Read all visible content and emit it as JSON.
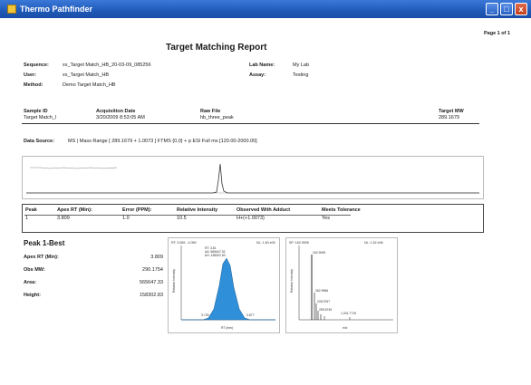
{
  "window": {
    "title": "Thermo Pathfinder",
    "buttons": [
      "_",
      "□",
      "x"
    ]
  },
  "report": {
    "page_number": "Page 1 of 1",
    "title": "Target Matching Report",
    "header": {
      "sequence_label": "Sequence:",
      "sequence_value": "xx_Target Match_HB_20-03-09_085256",
      "user_label": "User:",
      "user_value": "xx_Target Match_HB",
      "method_label": "Method:",
      "method_value": "Demo Target Match_HB",
      "lab_label": "Lab Name:",
      "lab_value": "My Lab",
      "assay_label": "Assay:",
      "assay_value": "Testing"
    },
    "sample_table": {
      "headers": [
        "Sample ID",
        "Acquisition Date",
        "Raw File",
        "Target MW"
      ],
      "row": [
        "Target Match_l",
        "3/20/2009 8:53:05 AM",
        "hb_three_peak",
        "289.1679"
      ]
    },
    "data_source": {
      "label": "Data Source:",
      "value": "MS | Mass Range [ 289.1679 + 1.0073 ] FTMS {0,0}  + p ESI Full ms [120.00-2000.00]"
    },
    "peak_table": {
      "headers": [
        "Peak",
        "Apex RT (Min):",
        "Error (PPM):",
        "Relative Intensity",
        "Observed With Adduct",
        "Meets Tolerance"
      ],
      "row": [
        "1",
        "3.809",
        "1.0",
        "10.5",
        "H+(+1.0073)",
        "Yes"
      ]
    },
    "peak_best": {
      "title": "Peak 1-Best",
      "rows": [
        {
          "label": "Apex RT (Min):",
          "value": "3.809"
        },
        {
          "label": "Obs MW:",
          "value": "290.1754"
        },
        {
          "label": "Area:",
          "value": "565647.33"
        },
        {
          "label": "Height:",
          "value": "158302.83"
        }
      ]
    },
    "chromatogram_panel": {
      "header_left": "RT: 3.559 - 4.059",
      "header_right": "NL: 1.60 e05",
      "annotations": [
        "RT: 3.81",
        "AA: 565647.33",
        "AH: 158302.83"
      ],
      "rt_labels": [
        "3.725",
        "3.877"
      ],
      "x_label": "RT (min)",
      "y_label": "Relative Intensity"
    },
    "spectrum_panel": {
      "header_left": "SP: 162.9005",
      "header_right": "NL: 1.52 e06",
      "peak_labels": [
        "162.9005",
        "262.9956",
        "228.9767",
        "259.8749",
        "1,001.7719"
      ],
      "x_label": "m/z",
      "y_label": "Relative Intensity"
    }
  },
  "colors": {
    "titlebar": "#1f5ab8",
    "peak_fill": "#2f8fd8",
    "trace": "#333333"
  }
}
